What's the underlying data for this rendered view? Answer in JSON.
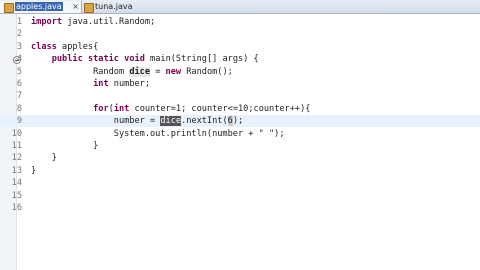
{
  "tabs": [
    {
      "label": "apples.java",
      "active": true
    },
    {
      "label": "tuna.java",
      "active": false
    }
  ],
  "lines": [
    {
      "num": "1",
      "segments": [
        {
          "t": "import java.util.Random;"
        }
      ]
    },
    {
      "num": "2",
      "segments": []
    },
    {
      "num": "3",
      "segments": [
        {
          "t": "class apples{"
        }
      ]
    },
    {
      "num": "4",
      "fold": true,
      "segments": [
        {
          "t": "    public static void main(String[] args) {"
        }
      ]
    },
    {
      "num": "5",
      "segments": [
        {
          "t": "            Random "
        },
        {
          "t": "dice",
          "cls": "var-hl"
        },
        {
          "t": " = new Random();"
        }
      ]
    },
    {
      "num": "6",
      "segments": [
        {
          "t": "            int number;"
        }
      ]
    },
    {
      "num": "7",
      "segments": []
    },
    {
      "num": "8",
      "segments": [
        {
          "t": "            for(int counter=1; counter<=10;counter++){"
        }
      ]
    },
    {
      "num": "9",
      "current": true,
      "segments": [
        {
          "t": "                number = "
        },
        {
          "t": "dice",
          "cls": "sel"
        },
        {
          "t": ".nextInt("
        },
        {
          "t": "6",
          "cls": "caret-hl"
        },
        {
          "t": ");"
        }
      ]
    },
    {
      "num": "10",
      "segments": [
        {
          "t": "                System.out.println(number + \" \");"
        }
      ]
    },
    {
      "num": "11",
      "segments": [
        {
          "t": "            }"
        }
      ]
    },
    {
      "num": "12",
      "segments": [
        {
          "t": "    }"
        }
      ]
    },
    {
      "num": "13",
      "segments": [
        {
          "t": "}"
        }
      ]
    },
    {
      "num": "14",
      "segments": []
    },
    {
      "num": "15",
      "segments": []
    },
    {
      "num": "16",
      "segments": []
    }
  ],
  "colors": {
    "keyword": "#7f0055",
    "selection": "#555555",
    "current_line": "#e8f2fe"
  }
}
